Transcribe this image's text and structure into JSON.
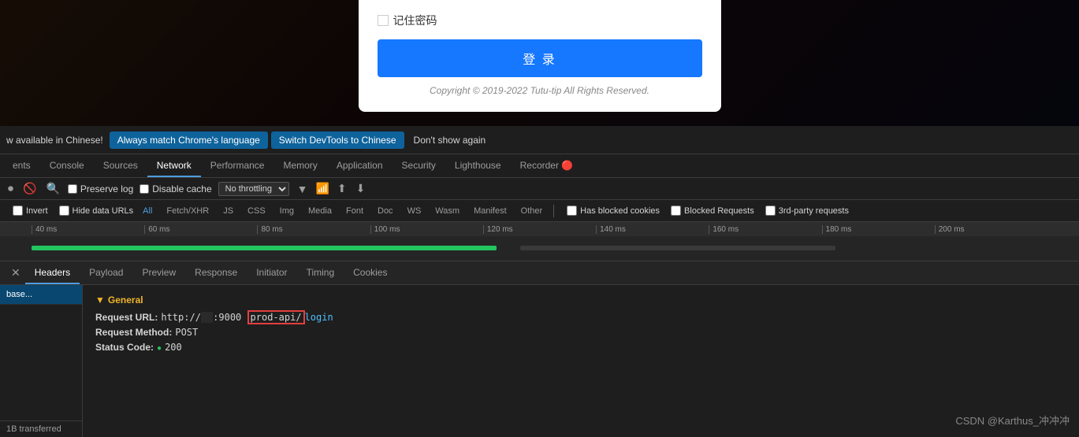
{
  "background": {
    "color": "#2a1a0a"
  },
  "login_modal": {
    "remember_label": "记住密码",
    "login_button": "登 录",
    "copyright": "Copyright © 2019-2022 Tutu-tip All Rights Reserved."
  },
  "banner": {
    "prefix_text": "w available in Chinese!",
    "btn_match": "Always match Chrome's language",
    "btn_switch": "Switch DevTools to Chinese",
    "btn_dismiss": "Don't show again"
  },
  "devtools_tabs": [
    {
      "label": "ents",
      "active": false
    },
    {
      "label": "Console",
      "active": false
    },
    {
      "label": "Sources",
      "active": false
    },
    {
      "label": "Network",
      "active": true
    },
    {
      "label": "Performance",
      "active": false
    },
    {
      "label": "Memory",
      "active": false
    },
    {
      "label": "Application",
      "active": false
    },
    {
      "label": "Security",
      "active": false
    },
    {
      "label": "Lighthouse",
      "active": false
    },
    {
      "label": "Recorder 🔴",
      "active": false
    }
  ],
  "network_toolbar": {
    "preserve_log": "Preserve log",
    "disable_cache": "Disable cache",
    "throttle": "No throttling"
  },
  "filter_bar": {
    "invert": "Invert",
    "hide_data_urls": "Hide data URLs",
    "all": "All",
    "fetch_xhr": "Fetch/XHR",
    "js": "JS",
    "css": "CSS",
    "img": "Img",
    "media": "Media",
    "font": "Font",
    "doc": "Doc",
    "ws": "WS",
    "wasm": "Wasm",
    "manifest": "Manifest",
    "other": "Other",
    "blocked_cookies": "Has blocked cookies",
    "blocked_requests": "Blocked Requests",
    "third_party": "3rd-party requests"
  },
  "timeline_ruler": {
    "ticks": [
      "40 ms",
      "60 ms",
      "80 ms",
      "100 ms",
      "120 ms",
      "140 ms",
      "160 ms",
      "180 ms",
      "200 ms"
    ]
  },
  "request_tabs": [
    {
      "label": "Headers",
      "active": true
    },
    {
      "label": "Payload",
      "active": false
    },
    {
      "label": "Preview",
      "active": false
    },
    {
      "label": "Response",
      "active": false
    },
    {
      "label": "Initiator",
      "active": false
    },
    {
      "label": "Timing",
      "active": false
    },
    {
      "label": "Cookies",
      "active": false
    }
  ],
  "request_list": {
    "item": "base...",
    "status": "1B transferred"
  },
  "general_section": {
    "title": "▼ General",
    "request_url_label": "Request URL:",
    "request_url_prefix": "http://",
    "request_url_masked": "            ",
    "request_url_port": ":9000 ",
    "request_url_path_highlighted": "prod-api/",
    "request_url_path_rest": "login",
    "request_method_label": "Request Method:",
    "request_method_value": "POST",
    "status_code_label": "Status Code:",
    "status_dot": "●",
    "status_code_value": "200"
  },
  "csdn_watermark": "CSDN @Karthus_冲冲冲"
}
